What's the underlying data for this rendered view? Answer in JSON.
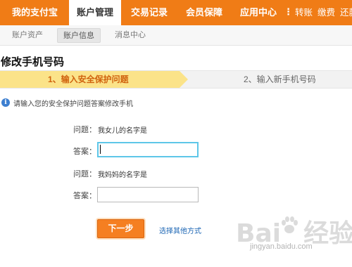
{
  "topnav": {
    "items": [
      {
        "label": "我的支付宝"
      },
      {
        "label": "账户管理"
      },
      {
        "label": "交易记录"
      },
      {
        "label": "会员保障"
      },
      {
        "label": "应用中心"
      }
    ],
    "separator": "⋮",
    "quick": [
      "转账",
      "缴费",
      "还款"
    ]
  },
  "subnav": {
    "items": [
      {
        "label": "账户资产"
      },
      {
        "label": "账户信息"
      },
      {
        "label": "消息中心"
      }
    ]
  },
  "page": {
    "title": "修改手机号码"
  },
  "steps": {
    "step1": "1、输入安全保护问题",
    "step2": "2、输入新手机号码"
  },
  "info": {
    "icon": "info-icon",
    "text": "请输入您的安全保护问题答案修改手机"
  },
  "form": {
    "q1_label": "问题：",
    "q1_text": "我女儿的名字是",
    "a1_label": "答案：",
    "a1_value": "",
    "q2_label": "问题：",
    "q2_text": "我妈妈的名字是",
    "a2_label": "答案：",
    "a2_value": ""
  },
  "actions": {
    "next": "下一步",
    "other": "选择其他方式"
  },
  "watermark": {
    "logo": "Bai 经验",
    "url": "jingyan.baidu.com"
  },
  "colors": {
    "nav_orange": "#f07c16",
    "step_yellow": "#fbe389",
    "step_text": "#d0620e",
    "button_orange": "#f57f21",
    "link_blue": "#1a64b3",
    "focus_blue": "#5ec6e8"
  }
}
